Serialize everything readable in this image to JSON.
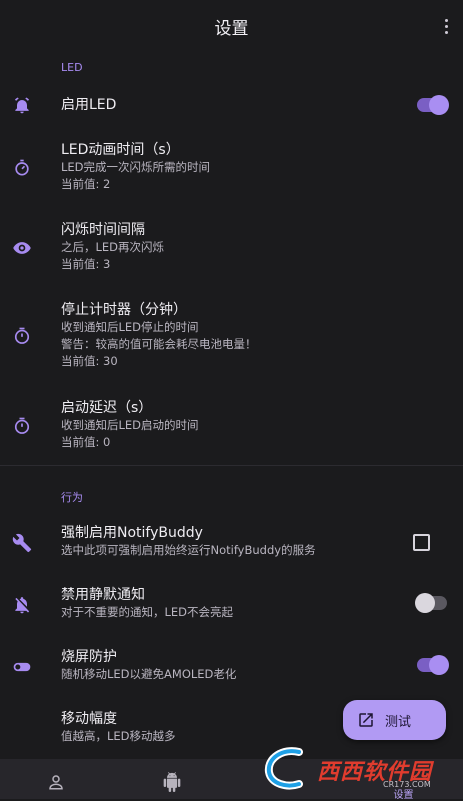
{
  "appbar": {
    "title": "设置",
    "menu_icon": "more-vert-icon"
  },
  "colors": {
    "accent": "#a98ef2",
    "background": "#1b1b1d"
  },
  "sections": {
    "led": {
      "header": "LED"
    },
    "behavior": {
      "header": "行为"
    }
  },
  "settings": {
    "enable_led": {
      "icon": "alarm-icon",
      "title": "启用LED",
      "toggle": true
    },
    "led_anim_time": {
      "icon": "timer-icon",
      "title": "LED动画时间（s）",
      "desc": "LED完成一次闪烁所需的时间",
      "value": "当前值: 2"
    },
    "blink_interval": {
      "icon": "eye-icon",
      "title": "闪烁时间间隔",
      "desc": "之后，LED再次闪烁",
      "value": "当前值: 3"
    },
    "stop_timer": {
      "icon": "stopwatch-icon",
      "title": "停止计时器（分钟）",
      "desc": "收到通知后LED停止的时间",
      "warning": "警告：较高的值可能会耗尽电池电量！",
      "value": "当前值: 30"
    },
    "start_delay": {
      "icon": "stopwatch-icon",
      "title": "启动延迟（s）",
      "desc": "收到通知后LED启动的时间",
      "value": "当前值: 0"
    },
    "force_enable": {
      "icon": "wrench-icon",
      "title": "强制启用NotifyBuddy",
      "desc": "选中此项可强制启用始终运行NotifyBuddy的服务",
      "checked": false
    },
    "disable_silent": {
      "icon": "notifications-off-icon",
      "title": "禁用静默通知",
      "desc": "对于不重要的通知，LED不会亮起",
      "toggle": false
    },
    "burn_in": {
      "icon": "toggle-icon",
      "title": "烧屏防护",
      "desc": "随机移动LED以避免AMOLED老化",
      "toggle": true
    },
    "move_range": {
      "title": "移动幅度",
      "desc": "值越高，LED移动越多"
    }
  },
  "fab": {
    "icon": "open-in-new-icon",
    "label": "测试"
  },
  "bottom_nav": {
    "items": [
      {
        "icon": "person-icon"
      },
      {
        "icon": "android-icon"
      },
      {
        "icon": "settings-icon",
        "label": "设置"
      }
    ]
  },
  "watermark": {
    "text": "西西软件园",
    "url": "CR173.COM"
  }
}
